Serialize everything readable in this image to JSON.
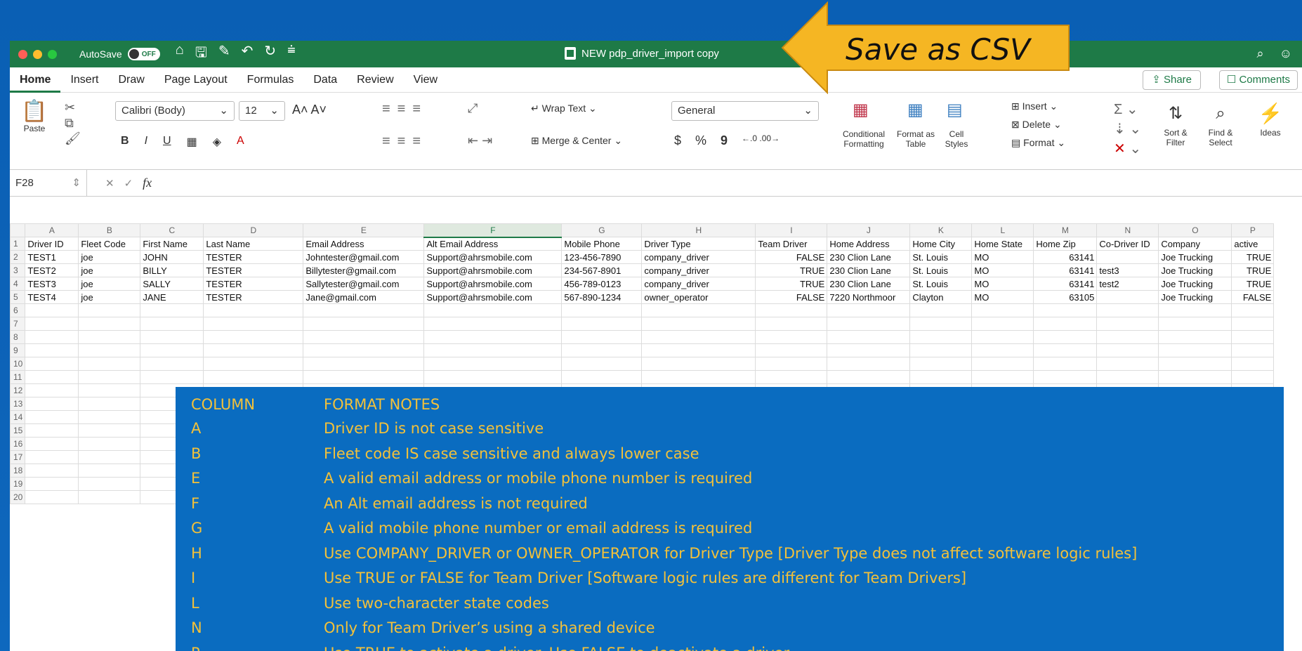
{
  "window": {
    "autosave_label": "AutoSave",
    "autosave_state": "OFF",
    "doc_title": "NEW pdp_driver_import copy"
  },
  "menu": [
    "Home",
    "Insert",
    "Draw",
    "Page Layout",
    "Formulas",
    "Data",
    "Review",
    "View"
  ],
  "menu_right": {
    "share": "Share",
    "comments": "Comments"
  },
  "ribbon": {
    "paste": "Paste",
    "font": "Calibri (Body)",
    "size": "12",
    "bold": "B",
    "italic": "I",
    "underline": "U",
    "wrap": "Wrap Text",
    "merge": "Merge & Center",
    "number_format": "General",
    "currency": "$",
    "percent": "%",
    "comma": "9",
    "cond_format": "Conditional Formatting",
    "format_table": "Format as Table",
    "cell_styles": "Cell Styles",
    "insert": "Insert",
    "delete": "Delete",
    "format": "Format",
    "sort": "Sort & Filter",
    "find": "Find & Select",
    "ideas": "Ideas"
  },
  "formula_bar": {
    "cell_ref": "F28",
    "fx": "fx"
  },
  "columns": [
    "A",
    "B",
    "C",
    "D",
    "E",
    "F",
    "G",
    "H",
    "I",
    "J",
    "K",
    "L",
    "M",
    "N",
    "O",
    "P"
  ],
  "rows": [
    [
      "Driver ID",
      "Fleet Code",
      "First Name",
      "Last Name",
      "Email Address",
      "Alt Email Address",
      "Mobile Phone",
      "Driver Type",
      "Team Driver",
      "Home Address",
      "Home City",
      "Home State",
      "Home Zip",
      "Co-Driver ID",
      "Company",
      "active"
    ],
    [
      "TEST1",
      "joe",
      "JOHN",
      "TESTER",
      "Johntester@gmail.com",
      "Support@ahrsmobile.com",
      "123-456-7890",
      "company_driver",
      "FALSE",
      "230 Clion Lane",
      "St. Louis",
      "MO",
      "63141",
      "",
      "Joe Trucking",
      "TRUE"
    ],
    [
      "TEST2",
      "joe",
      "BILLY",
      "TESTER",
      "Billytester@gmail.com",
      "Support@ahrsmobile.com",
      "234-567-8901",
      "company_driver",
      "TRUE",
      "230 Clion Lane",
      "St. Louis",
      "MO",
      "63141",
      "test3",
      "Joe Trucking",
      "TRUE"
    ],
    [
      "TEST3",
      "joe",
      "SALLY",
      "TESTER",
      "Sallytester@gmail.com",
      "Support@ahrsmobile.com",
      "456-789-0123",
      "company_driver",
      "TRUE",
      "230 Clion Lane",
      "St. Louis",
      "MO",
      "63141",
      "test2",
      "Joe Trucking",
      "TRUE"
    ],
    [
      "TEST4",
      "joe",
      "JANE",
      "TESTER",
      "Jane@gmail.com",
      "Support@ahrsmobile.com",
      "567-890-1234",
      "owner_operator",
      "FALSE",
      "7220 Northmoor",
      "Clayton",
      "MO",
      "63105",
      "",
      "Joe Trucking",
      "FALSE"
    ]
  ],
  "row_numbers": [
    "1",
    "2",
    "3",
    "4",
    "5",
    "6",
    "7",
    "8",
    "9",
    "10",
    "11",
    "12",
    "13",
    "14",
    "15",
    "16",
    "17",
    "18",
    "19",
    "20"
  ],
  "callout": "Save as CSV",
  "notes": {
    "header": [
      "COLUMN",
      "FORMAT NOTES"
    ],
    "items": [
      [
        "A",
        "Driver ID is not case sensitive"
      ],
      [
        "B",
        "Fleet code IS case sensitive and always lower case"
      ],
      [
        "E",
        "A valid email address or mobile phone number is required"
      ],
      [
        "F",
        "An Alt email address is not required"
      ],
      [
        "G",
        "A valid mobile phone number or email address is required"
      ],
      [
        "H",
        "Use COMPANY_DRIVER or OWNER_OPERATOR for Driver Type [Driver Type does not affect software logic rules]"
      ],
      [
        "I",
        "Use TRUE or FALSE for Team Driver [Software logic rules are different for Team Drivers]"
      ],
      [
        "L",
        "Use two-character state codes"
      ],
      [
        "N",
        "Only for Team Driver’s using a shared device"
      ],
      [
        "P",
        "Use TRUE to activate a driver. Use FALSE to deactivate a driver"
      ]
    ]
  },
  "colors": {
    "excel_green": "#1e7a47",
    "notes_bg": "#0a6cc0",
    "notes_text": "#f3c13a",
    "arrow": "#f5b623"
  }
}
